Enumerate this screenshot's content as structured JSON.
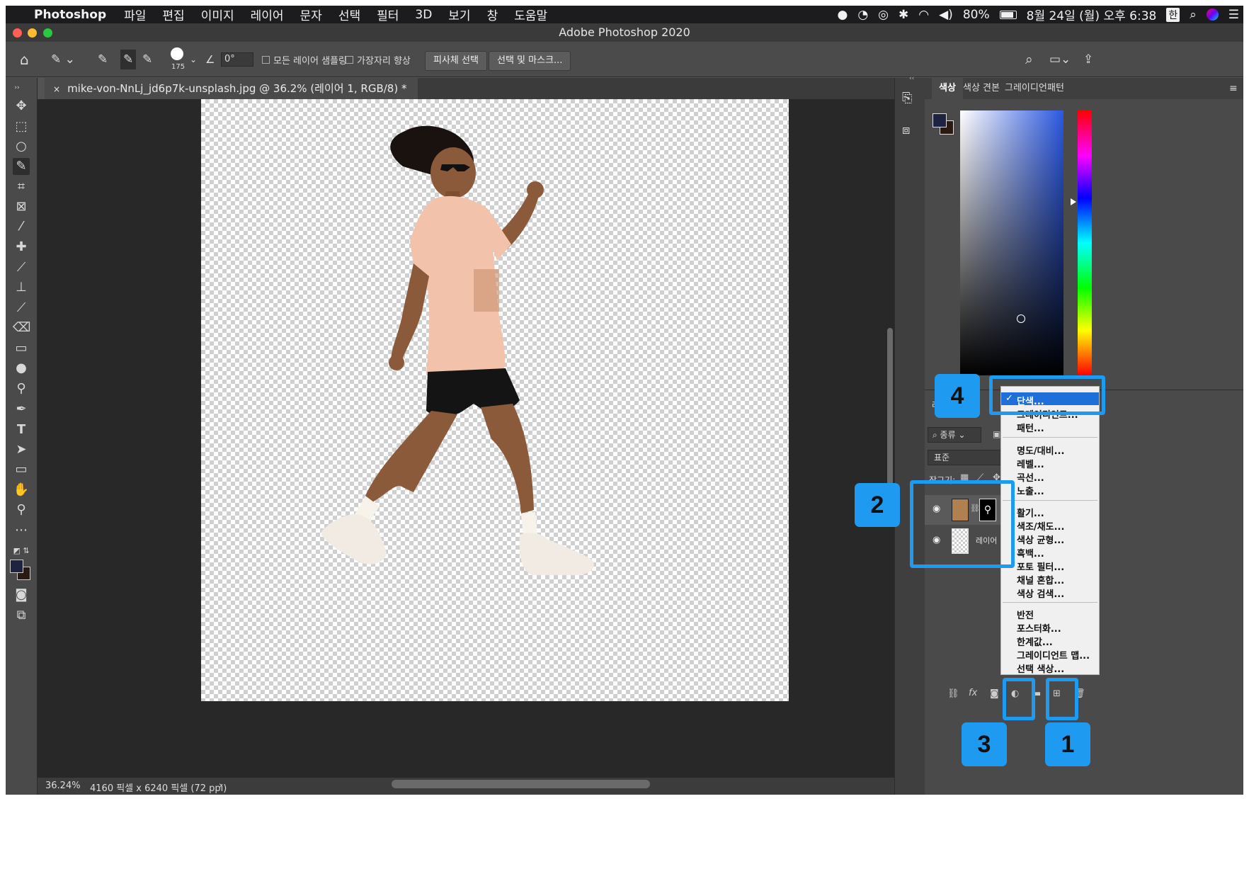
{
  "menubar": {
    "app_name": "Photoshop",
    "items": [
      "파일",
      "편집",
      "이미지",
      "레이어",
      "문자",
      "선택",
      "필터",
      "3D",
      "보기",
      "창",
      "도움말"
    ],
    "battery": "80%",
    "clock": "8월 24일 (월) 오후 6:38",
    "input_method": "한"
  },
  "window": {
    "title": "Adobe Photoshop 2020"
  },
  "options_bar": {
    "brush_size": "175",
    "angle": "0°",
    "sample_all_layers": "모든 레이어 샘플링",
    "enhance_edge": "가장자리 향상",
    "select_subject": "피사체 선택",
    "select_and_mask": "선택 및 마스크..."
  },
  "document": {
    "tab_title": "mike-von-NnLj_jd6p7k-unsplash.jpg @ 36.2% (레이어 1, RGB/8) *",
    "zoom": "36.24%",
    "info": "4160 픽셀 x 6240 픽셀 (72 ppi)"
  },
  "color_panel": {
    "tabs": [
      "색상",
      "색상 견본",
      "그레이디언",
      "패턴"
    ],
    "foreground": "#1d2340",
    "background": "#2a1a12"
  },
  "layers_panel": {
    "tab_label": "레",
    "filter_kind": "종류",
    "blend_mode": "표준",
    "lock_label": "잠그기:",
    "layers": [
      {
        "name": "",
        "has_mask": true
      },
      {
        "name": "레이어 1",
        "has_mask": false
      }
    ]
  },
  "adjustment_menu": {
    "groups": [
      [
        "단색...",
        "그레이디언트...",
        "패턴..."
      ],
      [
        "명도/대비...",
        "레벨...",
        "곡선...",
        "노출..."
      ],
      [
        "활기...",
        "색조/채도...",
        "색상 균형...",
        "흑백...",
        "포토 필터...",
        "채널 혼합...",
        "색상 검색..."
      ],
      [
        "반전",
        "포스터화...",
        "한계값...",
        "그레이디언트 맵...",
        "선택 색상..."
      ]
    ],
    "checked": "단색..."
  },
  "annotations": {
    "badges": [
      "1",
      "2",
      "3",
      "4"
    ],
    "color": "#1e9bf0"
  }
}
